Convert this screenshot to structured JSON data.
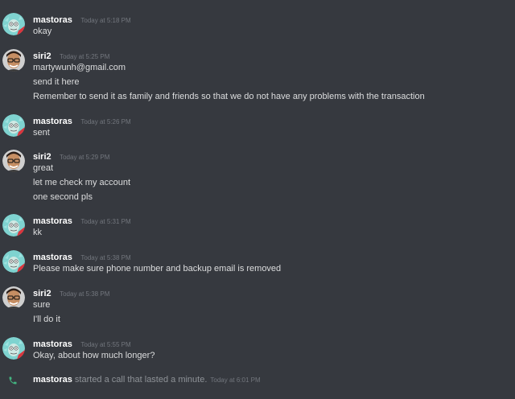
{
  "messages": [
    {
      "user": "mastoras",
      "time": "Today at 5:18 PM",
      "avatar_icon": "rick-avatar-icon",
      "lines": [
        "okay"
      ]
    },
    {
      "user": "siri2",
      "time": "Today at 5:25 PM",
      "avatar_icon": "man-glasses-avatar-icon",
      "lines": [
        "martywunh@gmail.com",
        "send it here",
        "Remember to send it as family and friends so that we do not have any problems with the transaction"
      ]
    },
    {
      "user": "mastoras",
      "time": "Today at 5:26 PM",
      "avatar_icon": "rick-avatar-icon",
      "lines": [
        "sent"
      ]
    },
    {
      "user": "siri2",
      "time": "Today at 5:29 PM",
      "avatar_icon": "man-glasses-avatar-icon",
      "lines": [
        "great",
        "let me check my account",
        "one second pls"
      ]
    },
    {
      "user": "mastoras",
      "time": "Today at 5:31 PM",
      "avatar_icon": "rick-avatar-icon",
      "lines": [
        "kk"
      ]
    },
    {
      "user": "mastoras",
      "time": "Today at 5:38 PM",
      "avatar_icon": "rick-avatar-icon",
      "lines": [
        "Please make sure phone number and backup email is removed"
      ]
    },
    {
      "user": "siri2",
      "time": "Today at 5:38 PM",
      "avatar_icon": "man-glasses-avatar-icon",
      "lines": [
        "sure",
        "I'll do it"
      ]
    },
    {
      "user": "mastoras",
      "time": "Today at 5:55 PM",
      "avatar_icon": "rick-avatar-icon",
      "lines": [
        "Okay, about how much longer?"
      ]
    }
  ],
  "call": {
    "user": "mastoras",
    "text": "started a call that lasted a minute.",
    "time": "Today at 6:01 PM",
    "icon": "phone-icon"
  },
  "colors": {
    "background": "#36393f",
    "username": "#ffffff",
    "message_text": "#dcddde",
    "timestamp": "#72767d",
    "call_text": "#8e9297",
    "phone_green": "#43b581"
  }
}
